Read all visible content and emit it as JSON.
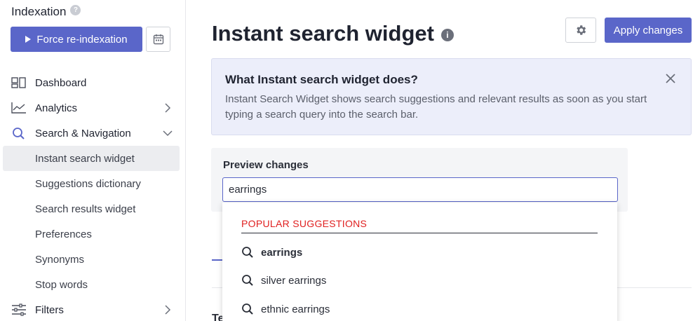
{
  "sidebar": {
    "section_title": "Indexation",
    "help_symbol": "?",
    "force_button_label": "Force re-indexation",
    "nav": [
      {
        "label": "Dashboard",
        "icon": "dashboard-icon"
      },
      {
        "label": "Analytics",
        "icon": "chart-icon"
      },
      {
        "label": "Search & Navigation",
        "icon": "search-icon"
      },
      {
        "label": "Filters",
        "icon": "sliders-icon"
      }
    ],
    "sub_items": [
      {
        "label": "Instant search widget",
        "active": true
      },
      {
        "label": "Suggestions dictionary"
      },
      {
        "label": "Search results widget"
      },
      {
        "label": "Preferences"
      },
      {
        "label": "Synonyms"
      },
      {
        "label": "Stop words"
      }
    ]
  },
  "header": {
    "title": "Instant search widget",
    "info_symbol": "i",
    "apply_label": "Apply changes"
  },
  "info_box": {
    "heading": "What Instant search widget does?",
    "text": "Instant Search Widget shows search suggestions and relevant results as soon as you start typing a search query into the search bar."
  },
  "preview": {
    "label": "Preview changes",
    "input_value": "earrings"
  },
  "dropdown": {
    "header": "POPULAR SUGGESTIONS",
    "items": [
      "earrings",
      "silver earrings",
      "ethnic earrings"
    ]
  },
  "partial_text": "Te",
  "colors": {
    "accent": "#5a66c9",
    "suggestion_header": "#e02020",
    "info_bg": "#eceefa",
    "active_bg": "#ecedf0"
  }
}
